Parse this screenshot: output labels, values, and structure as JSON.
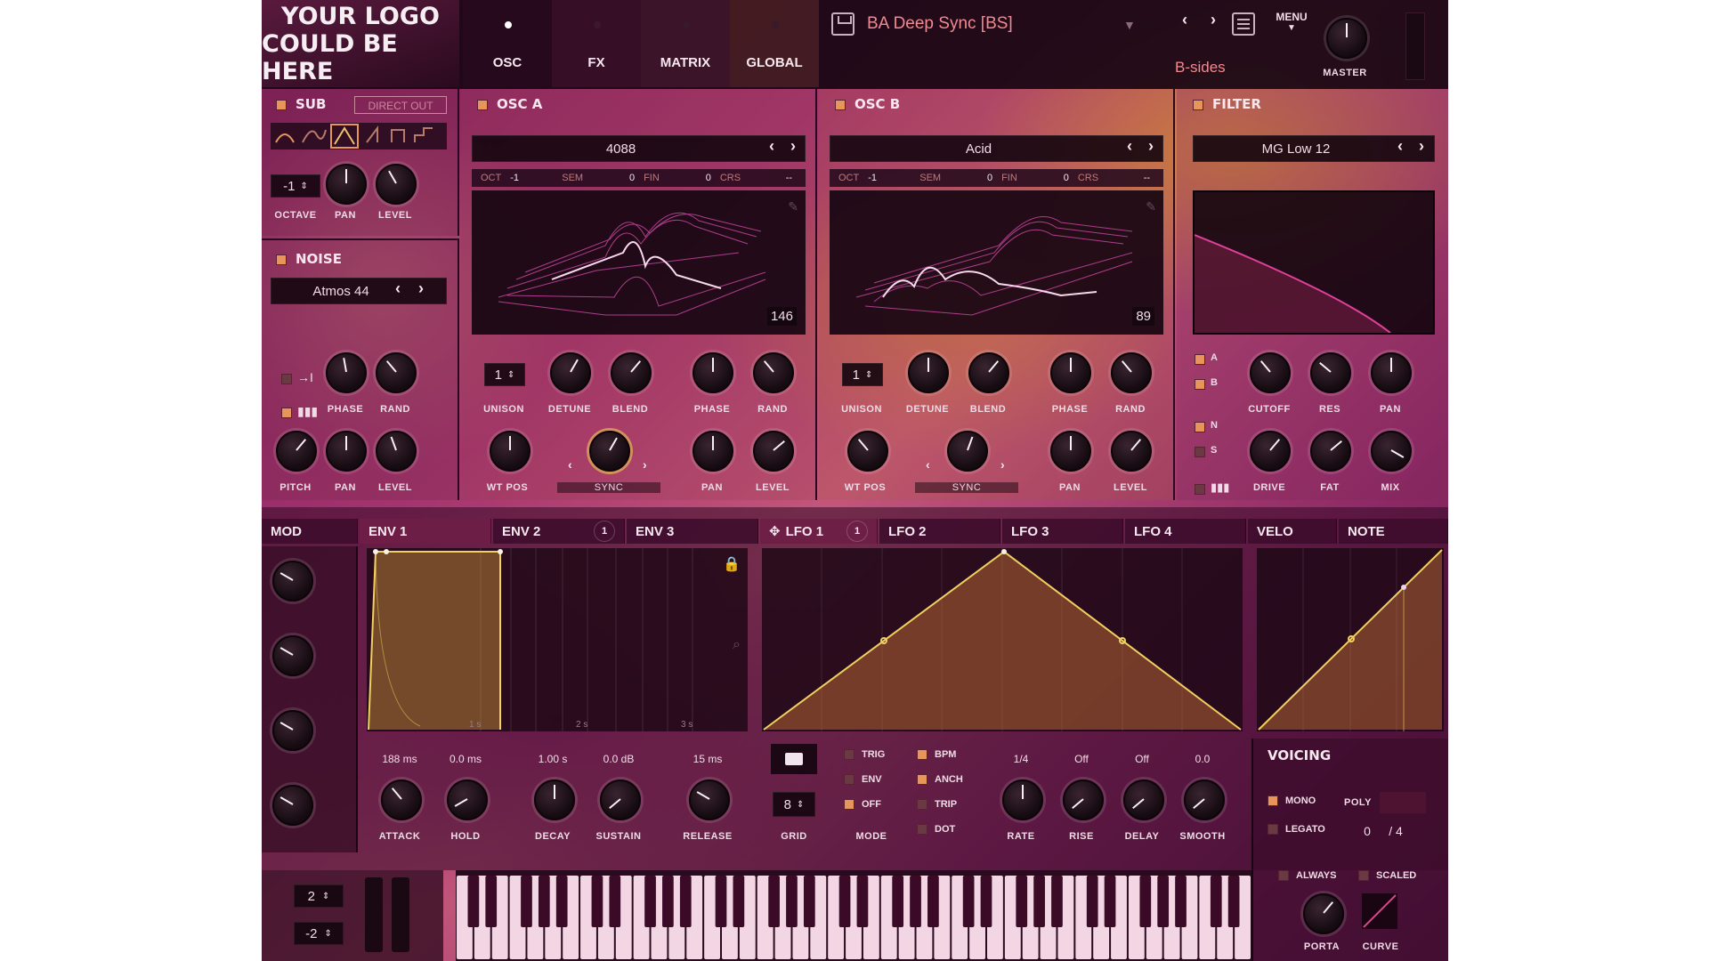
{
  "header": {
    "logo_line1": "YOUR LOGO",
    "logo_line2": "COULD BE HERE",
    "tabs": [
      "OSC",
      "FX",
      "MATRIX",
      "GLOBAL"
    ],
    "preset_name": "BA Deep Sync [BS]",
    "preset_bank": "B-sides",
    "menu_label": "MENU",
    "master_label": "MASTER"
  },
  "sub": {
    "title": "SUB",
    "direct_out": "DIRECT OUT",
    "octave_value": "-1",
    "labels": [
      "OCTAVE",
      "PAN",
      "LEVEL"
    ]
  },
  "noise": {
    "title": "NOISE",
    "preset": "Atmos 44",
    "labels": [
      "PHASE",
      "RAND",
      "PITCH",
      "PAN",
      "LEVEL"
    ]
  },
  "osc_a": {
    "title": "OSC  A",
    "wavetable": "4088",
    "oct_label": "OCT",
    "oct_value": "-1",
    "sem_label": "SEM",
    "sem_value": "0",
    "fin_label": "FIN",
    "fin_value": "0",
    "crs_label": "CRS",
    "crs_value": "--",
    "frame": "146",
    "unison_value": "1",
    "labels": [
      "UNISON",
      "DETUNE",
      "BLEND",
      "PHASE",
      "RAND",
      "WT POS",
      "SYNC",
      "PAN",
      "LEVEL"
    ]
  },
  "osc_b": {
    "title": "OSC  B",
    "wavetable": "Acid",
    "oct_label": "OCT",
    "oct_value": "-1",
    "sem_label": "SEM",
    "sem_value": "0",
    "fin_label": "FIN",
    "fin_value": "0",
    "crs_label": "CRS",
    "crs_value": "--",
    "frame": "89",
    "unison_value": "1",
    "labels": [
      "UNISON",
      "DETUNE",
      "BLEND",
      "PHASE",
      "RAND",
      "WT POS",
      "SYNC",
      "PAN",
      "LEVEL"
    ]
  },
  "filter": {
    "title": "FILTER",
    "type": "MG Low 12",
    "routes": [
      "A",
      "B",
      "N",
      "S"
    ],
    "labels": [
      "CUTOFF",
      "RES",
      "PAN",
      "DRIVE",
      "FAT",
      "MIX"
    ]
  },
  "mod_tabs": {
    "mod": "MOD",
    "env1": "ENV 1",
    "env2": "ENV 2",
    "env2_count": "1",
    "env3": "ENV 3",
    "lfo1": "LFO 1",
    "lfo1_count": "1",
    "lfo2": "LFO 2",
    "lfo3": "LFO 3",
    "lfo4": "LFO 4",
    "velo": "VELO",
    "note": "NOTE"
  },
  "env": {
    "grid_labels": [
      "1 s",
      "2 s",
      "3 s"
    ],
    "values": [
      "188 ms",
      "0.0 ms",
      "1.00 s",
      "0.0 dB",
      "15 ms"
    ],
    "labels": [
      "ATTACK",
      "HOLD",
      "DECAY",
      "SUSTAIN",
      "RELEASE"
    ]
  },
  "lfo": {
    "grid_value": "8",
    "grid_label": "GRID",
    "mode_options": [
      "TRIG",
      "ENV",
      "OFF"
    ],
    "mode_label": "MODE",
    "bpm_options": [
      "BPM",
      "ANCH",
      "TRIP",
      "DOT"
    ],
    "values": [
      "1/4",
      "Off",
      "Off",
      "0.0"
    ],
    "labels": [
      "RATE",
      "RISE",
      "DELAY",
      "SMOOTH"
    ]
  },
  "voicing": {
    "title": "VOICING",
    "mono": "MONO",
    "poly": "POLY",
    "legato": "LEGATO",
    "voices": "0",
    "voices_max": "/ 4",
    "always": "ALWAYS",
    "scaled": "SCALED",
    "porta": "PORTA",
    "curve": "CURVE"
  },
  "keyboard": {
    "pitch_up": "2",
    "pitch_down": "-2"
  },
  "colors": {
    "accent": "#e7955a",
    "curve": "#f0d060",
    "bg": "#8e2a66"
  }
}
